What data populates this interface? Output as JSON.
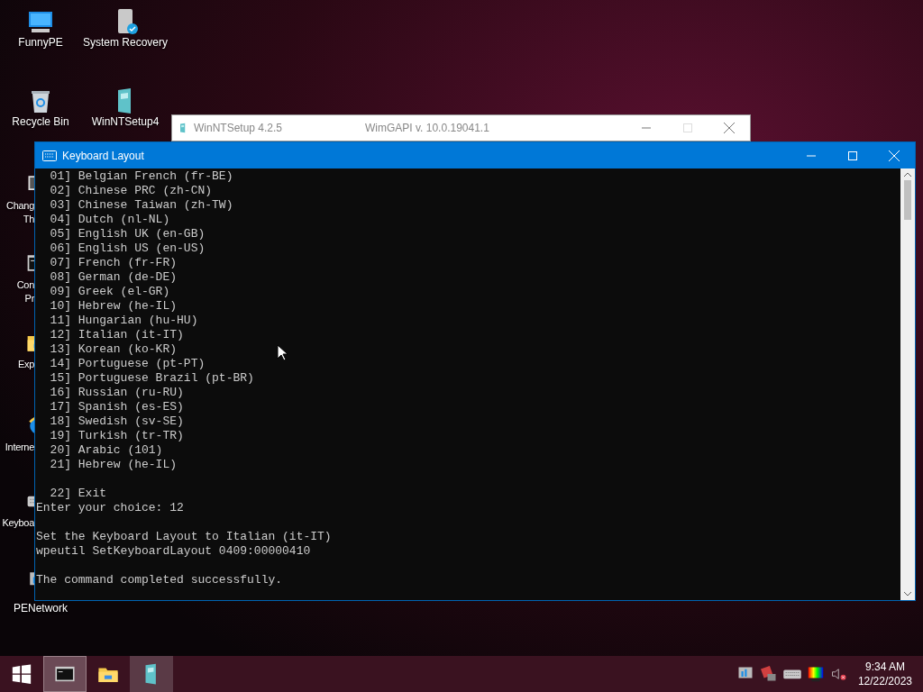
{
  "desktop_icons": [
    {
      "kind": "monitor",
      "lines": [
        "FunnyPE"
      ]
    },
    {
      "kind": "recovery",
      "lines": [
        "System Recovery"
      ]
    },
    {
      "kind": "recycle",
      "lines": [
        "Recycle Bin"
      ]
    },
    {
      "kind": "setup",
      "lines": [
        "WinNTSetup4"
      ]
    },
    {
      "kind": "theme",
      "lines": [
        "Chang",
        "Th"
      ]
    },
    {
      "kind": "console",
      "lines": [
        "Con",
        "Pr"
      ]
    },
    {
      "kind": "folder",
      "lines": [
        "Exp"
      ]
    },
    {
      "kind": "browser",
      "lines": [
        "Interne"
      ]
    },
    {
      "kind": "keyboard",
      "lines": [
        "Keyboa"
      ]
    },
    {
      "kind": "network",
      "lines": [
        "PENetwork"
      ]
    }
  ],
  "background_window": {
    "title": "WinNTSetup 4.2.5",
    "subtitle": "WimGAPI v. 10.0.19041.1"
  },
  "console_window": {
    "title": "Keyboard Layout",
    "blocks": [
      {
        "lines": [
          "  01] Belgian French (fr-BE)",
          "  02] Chinese PRC (zh-CN)",
          "  03] Chinese Taiwan (zh-TW)",
          "  04] Dutch (nl-NL)",
          "  05] English UK (en-GB)",
          "  06] English US (en-US)",
          "  07] French (fr-FR)",
          "  08] German (de-DE)",
          "  09] Greek (el-GR)",
          "  10] Hebrew (he-IL)",
          "  11] Hungarian (hu-HU)",
          "  12] Italian (it-IT)",
          "  13] Korean (ko-KR)",
          "  14] Portuguese (pt-PT)",
          "  15] Portuguese Brazil (pt-BR)",
          "  16] Russian (ru-RU)",
          "  17] Spanish (es-ES)",
          "  18] Swedish (sv-SE)",
          "  19] Turkish (tr-TR)",
          "  20] Arabic (101)",
          "  21] Hebrew (he-IL)"
        ]
      },
      {
        "lines": [
          "  22] Exit",
          "Enter your choice: 12"
        ]
      },
      {
        "lines": [
          "Set the Keyboard Layout to Italian (it-IT)",
          "wpeutil SetKeyboardLayout 0409:00000410"
        ]
      },
      {
        "lines": [
          "The command completed successfully."
        ]
      }
    ]
  },
  "taskbar": {
    "apps": [
      {
        "kind": "console",
        "selected": true
      },
      {
        "kind": "folder",
        "selected": false
      },
      {
        "kind": "setup",
        "selected": false
      }
    ],
    "tray": [
      {
        "kind": "network"
      },
      {
        "kind": "flag"
      },
      {
        "kind": "keyboard"
      },
      {
        "kind": "display"
      },
      {
        "kind": "volume"
      }
    ],
    "time": "9:34 AM",
    "date": "12/22/2023"
  }
}
